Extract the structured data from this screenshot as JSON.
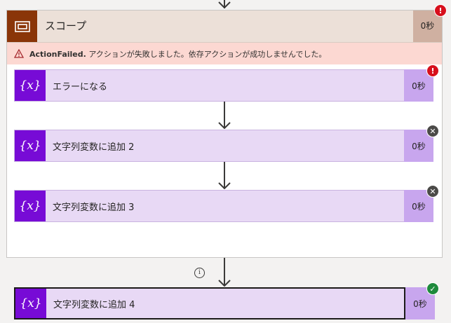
{
  "scope": {
    "title": "スコープ",
    "duration": "0秒",
    "error_code": "ActionFailed.",
    "error_message": "アクションが失敗しました。依存アクションが成功しませんでした。"
  },
  "actions": [
    {
      "label": "エラーになる",
      "duration": "0秒",
      "status": "failed",
      "icon": "variable-icon"
    },
    {
      "label": "文字列変数に追加 2",
      "duration": "0秒",
      "status": "skipped",
      "icon": "variable-icon"
    },
    {
      "label": "文字列変数に追加 3",
      "duration": "0秒",
      "status": "skipped",
      "icon": "variable-icon"
    },
    {
      "label": "文字列変数に追加 4",
      "duration": "0秒",
      "status": "succeeded",
      "icon": "variable-icon"
    }
  ],
  "status_colors": {
    "failed": "#d70f1c",
    "skipped": "#4b4a48",
    "succeeded": "#1e8a3c",
    "scope_accent": "#8a3508",
    "variable_accent": "#770bd6"
  },
  "icons": {
    "variable": "{x}",
    "info": "i"
  }
}
